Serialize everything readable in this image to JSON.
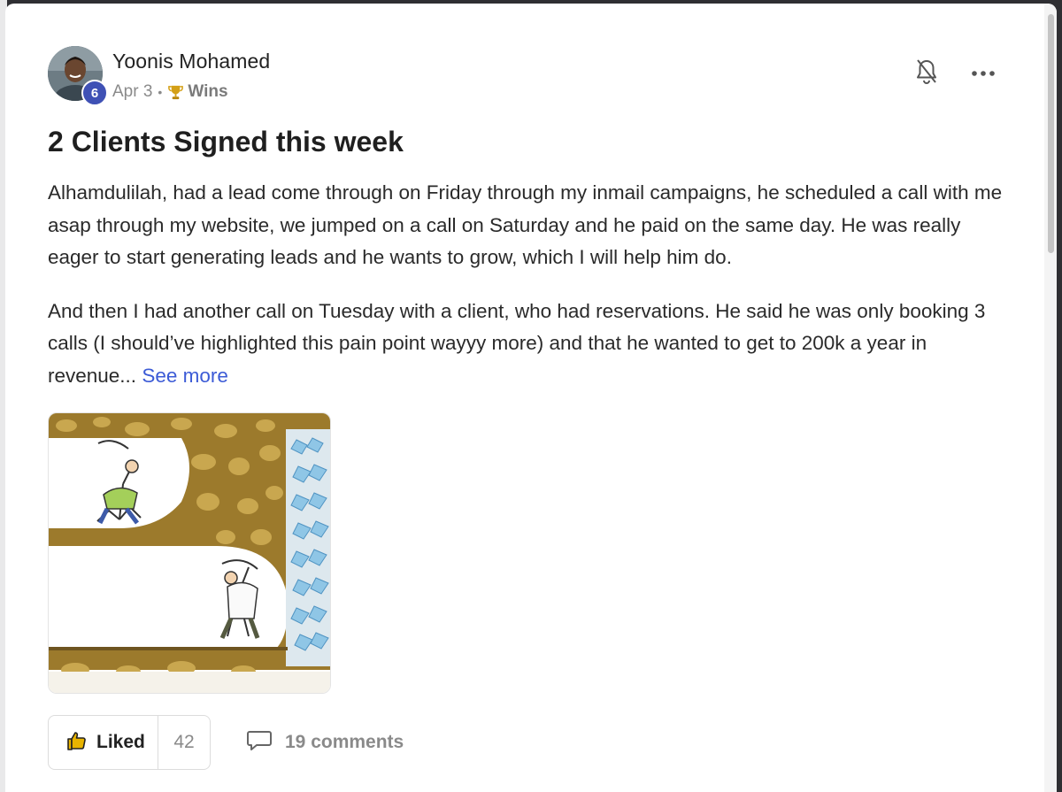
{
  "post": {
    "author": {
      "name": "Yoonis Mohamed",
      "level": "6"
    },
    "date": "Apr 3",
    "separator": "•",
    "category": "Wins",
    "title": "2 Clients Signed this week",
    "paragraphs": [
      "Alhamdulilah, had a lead come through on Friday through my inmail campaigns, he scheduled a call with me asap through my website, we jumped on a call on Saturday and he paid on the same day. He was really eager to start generating leads and he wants to grow, which I will help him do.",
      "And then I had another call on Tuesday with a client, who had reservations. He said he was only booking 3 calls (I should’ve highlighted this pain point wayyy more) and that he wanted to get to 200k a year in revenue..."
    ],
    "see_more": "See more",
    "attachment_icon": "miners-digging-toward-diamonds-cartoon"
  },
  "actions": {
    "like_label": "Liked",
    "like_count": "42",
    "comments_label": "19 comments"
  },
  "icons": {
    "bell": "bell-off-icon",
    "more": "more-horizontal-icon",
    "like": "thumbs-up-icon",
    "comment": "comment-bubble-icon",
    "trophy": "trophy-icon"
  },
  "colors": {
    "link": "#3c5bd6",
    "level_badge": "#3f51b5",
    "trophy": "#d4a017"
  }
}
